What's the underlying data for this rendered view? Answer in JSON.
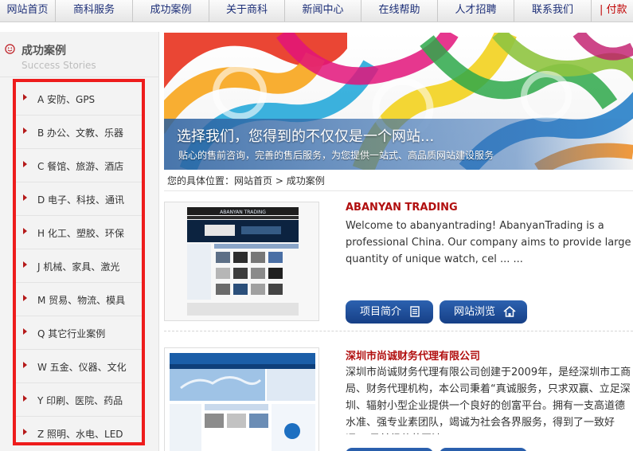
{
  "nav": {
    "items": [
      "网站首页",
      "商科服务",
      "成功案例",
      "关于商科",
      "新闻中心",
      "在线帮助",
      "人才招聘",
      "联系我们",
      "| 付款"
    ]
  },
  "sidebar": {
    "title": "成功案例",
    "subtitle": "Success Stories",
    "categories": [
      "A 安防、GPS",
      "B 办公、文教、乐器",
      "C 餐馆、旅游、酒店",
      "D 电子、科技、通讯",
      "H 化工、塑胶、环保",
      "J 机械、家具、激光",
      "M 贸易、物流、模具",
      "Q 其它行业案例",
      "W 五金、仪器、文化",
      "Y 印刷、医院、药品",
      "Z 照明、水电、LED"
    ]
  },
  "banner": {
    "title": "选择我们，您得到的不仅仅是一个网站...",
    "subtitle": "贴心的售前咨询，完善的售后服务，为您提供一站式、高品质网站建设服务"
  },
  "breadcrumb": {
    "prefix": "您的具体位置：",
    "home": "网站首页",
    "sep": " > ",
    "current": "成功案例"
  },
  "cases": [
    {
      "name": "ABANYAN TRADING",
      "desc": "Welcome to abanyantrading! AbanyanTrading  is a professional China. Our company aims to provide large quantity of unique watch, cel ... ...",
      "btn_intro": "项目简介",
      "btn_browse": "网站浏览",
      "thumb_title": "ABANYAN TRADING"
    },
    {
      "name": "深圳市尚诚财务代理有限公司",
      "desc": " 深圳市尚诚财务代理有限公司创建于2009年，是经深圳市工商局、财务代理机构，本公司秉着“真诚服务，只求双赢、立足深圳、辐射小型企业提供一个良好的创富平台。拥有一支高道德水准、强专业素团队，竭诚为社会各界服务，得到了一致好评。      目前经营范围涉"
    }
  ],
  "colors": {
    "accent_red": "#b10f0f",
    "nav_text": "#1d2f78",
    "button_blue": "#1f4f9c",
    "highlight_border": "#ee1c1c"
  }
}
